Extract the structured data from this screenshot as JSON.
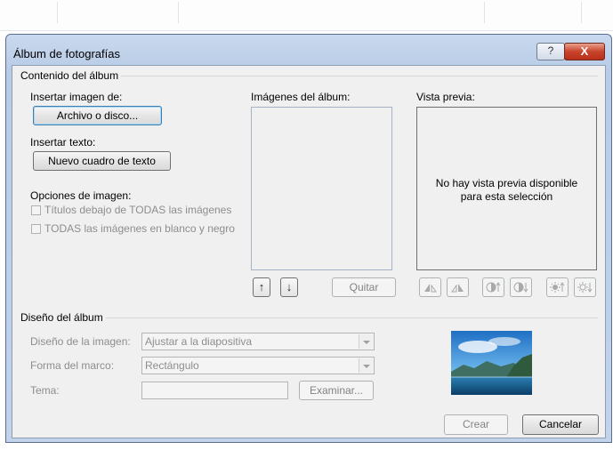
{
  "dialog": {
    "title": "Álbum de fotografías",
    "help_glyph": "?",
    "close_glyph": "X"
  },
  "content_group": {
    "label": "Contenido del álbum",
    "insert_image_label": "Insertar imagen de:",
    "file_or_disk_button": "Archivo o disco...",
    "insert_text_label": "Insertar texto:",
    "new_textbox_button": "Nuevo cuadro de texto",
    "image_options_label": "Opciones de imagen:",
    "caption_checkbox": "Títulos debajo de TODAS las imágenes",
    "bw_checkbox": "TODAS las imágenes en blanco y negro",
    "album_images_label": "Imágenes del álbum:",
    "move_up_glyph": "↑",
    "move_down_glyph": "↓",
    "remove_button": "Quitar",
    "preview_label": "Vista previa:",
    "preview_empty_text": "No hay vista previa disponible para esta selección",
    "tool_icons": [
      "rotate-left-icon",
      "rotate-right-icon",
      "contrast-up-icon",
      "contrast-down-icon",
      "brightness-up-icon",
      "brightness-down-icon"
    ]
  },
  "layout_group": {
    "label": "Diseño del álbum",
    "image_layout_label": "Diseño de la imagen:",
    "image_layout_value": "Ajustar a la diapositiva",
    "frame_shape_label": "Forma del marco:",
    "frame_shape_value": "Rectángulo",
    "theme_label": "Tema:",
    "theme_value": "",
    "browse_button": "Examinar..."
  },
  "footer": {
    "create_button": "Crear",
    "cancel_button": "Cancelar"
  }
}
